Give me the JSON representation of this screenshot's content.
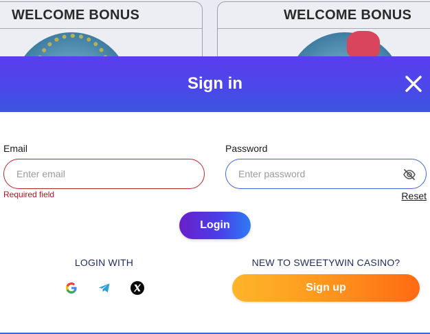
{
  "background": {
    "promo_cards": [
      {
        "title": "WELCOME BONUS"
      },
      {
        "title": "WELCOME BONUS"
      }
    ]
  },
  "modal": {
    "title": "Sign in",
    "close_icon": "close-icon"
  },
  "form": {
    "email": {
      "label": "Email",
      "placeholder": "Enter email",
      "value": "",
      "error": "Required field"
    },
    "password": {
      "label": "Password",
      "placeholder": "Enter password",
      "value": "",
      "visibility_icon": "eye-off-icon",
      "reset_label": "Reset"
    },
    "login_label": "Login"
  },
  "social": {
    "heading": "LOGIN WITH",
    "providers": [
      {
        "name": "Google",
        "icon": "google-icon"
      },
      {
        "name": "Telegram",
        "icon": "telegram-icon"
      },
      {
        "name": "X",
        "icon": "x-icon"
      }
    ]
  },
  "signup": {
    "heading": "NEW TO SWEETYWIN CASINO?",
    "button_label": "Sign up"
  },
  "colors": {
    "header_gradient_start": "#5b3df0",
    "header_gradient_end": "#3c55e0",
    "error": "#b5121b",
    "email_border": "#b8242b",
    "password_border": "#3d63e0",
    "signup_gradient_start": "#ffb52a",
    "signup_gradient_end": "#ff6a12"
  }
}
